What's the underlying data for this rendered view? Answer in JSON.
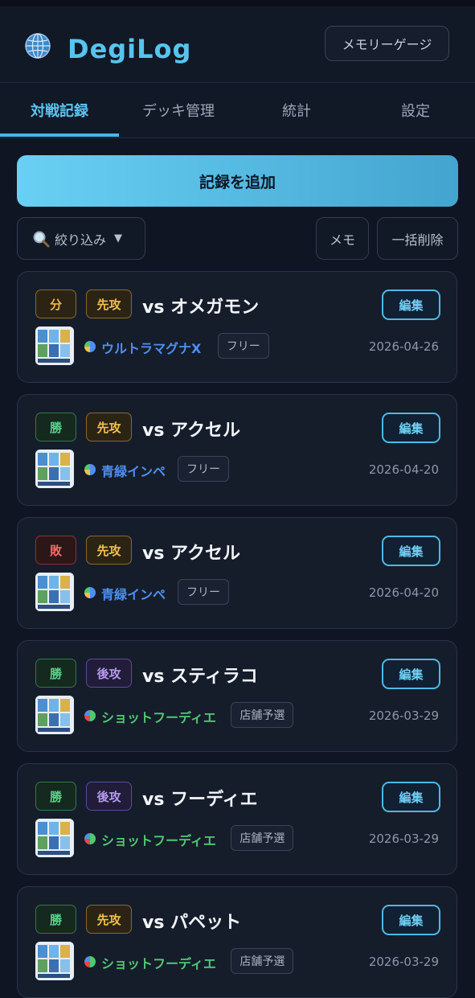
{
  "app": {
    "title": "DegiLog",
    "memory_button": "メモリーゲージ"
  },
  "tabs": [
    {
      "label": "対戦記録",
      "active": true
    },
    {
      "label": "デッキ管理",
      "active": false
    },
    {
      "label": "統計",
      "active": false
    },
    {
      "label": "設定",
      "active": false
    }
  ],
  "actions": {
    "add_record": "記録を追加",
    "filter": "絞り込み",
    "memo": "メモ",
    "bulk_delete": "一括削除"
  },
  "colors": {
    "accent": "#56c4ef",
    "win": "#58d48a",
    "lose": "#f06a6a",
    "draw": "#f0b34e",
    "first": "#f0c04e",
    "second": "#b59af0",
    "deck_blue": "#4f8ff0",
    "deck_green": "#4fc96f"
  },
  "records": [
    {
      "result": "分",
      "turn": "先攻",
      "opponent": "vs オメガモン",
      "edit": "編集",
      "deck": "ウルトラマグナX",
      "deck_color": "#4f8ff0",
      "tag": "フリー",
      "date": "2026-04-26"
    },
    {
      "result": "勝",
      "turn": "先攻",
      "opponent": "vs アクセル",
      "edit": "編集",
      "deck": "青緑インペ",
      "deck_color": "#4f8ff0",
      "tag": "フリー",
      "date": "2026-04-20"
    },
    {
      "result": "敗",
      "turn": "先攻",
      "opponent": "vs アクセル",
      "edit": "編集",
      "deck": "青緑インペ",
      "deck_color": "#4f8ff0",
      "tag": "フリー",
      "date": "2026-04-20"
    },
    {
      "result": "勝",
      "turn": "後攻",
      "opponent": "vs スティラコ",
      "edit": "編集",
      "deck": "ショットフーディエ",
      "deck_color": "#4fc96f",
      "tag": "店舗予選",
      "date": "2026-03-29"
    },
    {
      "result": "勝",
      "turn": "後攻",
      "opponent": "vs フーディエ",
      "edit": "編集",
      "deck": "ショットフーディエ",
      "deck_color": "#4fc96f",
      "tag": "店舗予選",
      "date": "2026-03-29"
    },
    {
      "result": "勝",
      "turn": "先攻",
      "opponent": "vs パペット",
      "edit": "編集",
      "deck": "ショットフーディエ",
      "deck_color": "#4fc96f",
      "tag": "店舗予選",
      "date": "2026-03-29"
    }
  ]
}
